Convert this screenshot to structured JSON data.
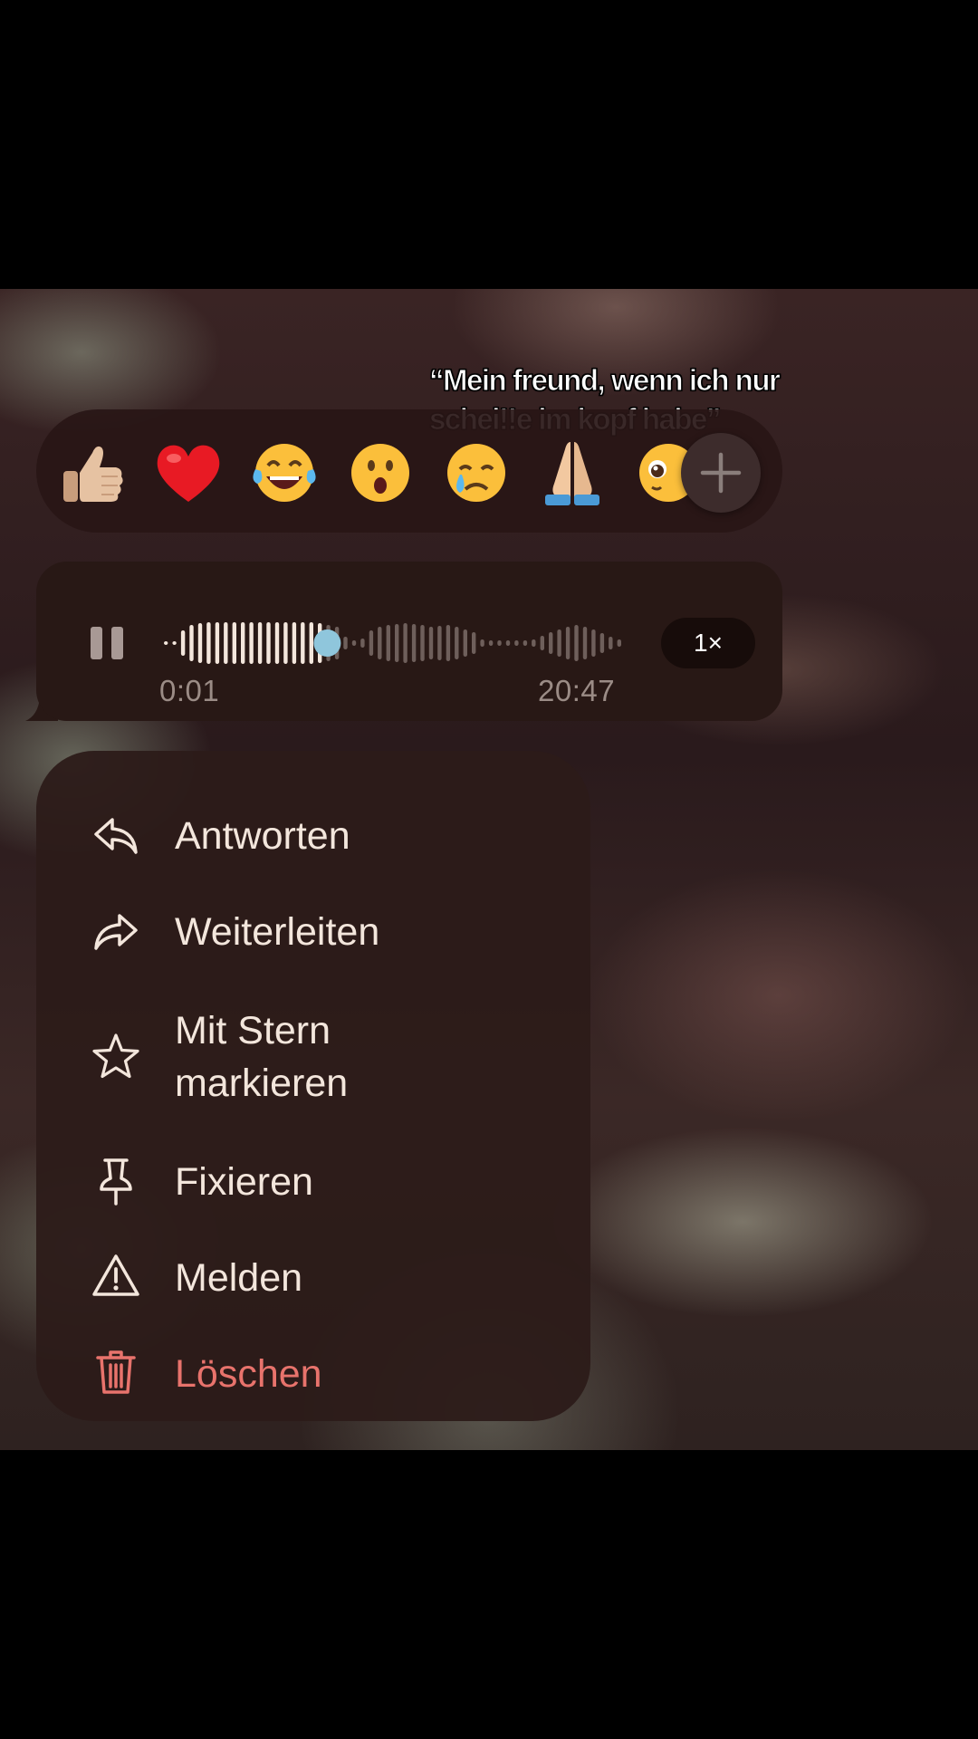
{
  "caption": {
    "line1": "“Mein freund, wenn ich nur",
    "line2": "schei!!e im kopf habe”"
  },
  "reactions": {
    "emojis": [
      {
        "name": "thumbs-up",
        "char": "👍🏼"
      },
      {
        "name": "red-heart",
        "char": "❤️"
      },
      {
        "name": "tears-of-joy",
        "char": "😂"
      },
      {
        "name": "surprised",
        "char": "😮"
      },
      {
        "name": "crying",
        "char": "😢"
      },
      {
        "name": "folded-hands",
        "char": "🙏"
      },
      {
        "name": "pleading",
        "char": "🥺"
      }
    ],
    "add_icon": "plus-icon"
  },
  "voice_message": {
    "elapsed": "0:01",
    "duration": "20:47",
    "speed": "1×",
    "progress_fraction": 0.35,
    "colors": {
      "played": "#f3e6dc",
      "unplayed": "#6e5f5b",
      "scrubber": "#8fc6dc"
    }
  },
  "menu": {
    "items": [
      {
        "label": "Antworten",
        "icon": "reply-icon"
      },
      {
        "label": "Weiterleiten",
        "icon": "forward-icon"
      },
      {
        "label": "Mit Stern\nmarkieren",
        "icon": "star-icon"
      },
      {
        "label": "Fixieren",
        "icon": "pin-icon"
      },
      {
        "label": "Melden",
        "icon": "warning-icon"
      },
      {
        "label": "Löschen",
        "icon": "trash-icon"
      }
    ],
    "danger_color": "#e8736c"
  }
}
